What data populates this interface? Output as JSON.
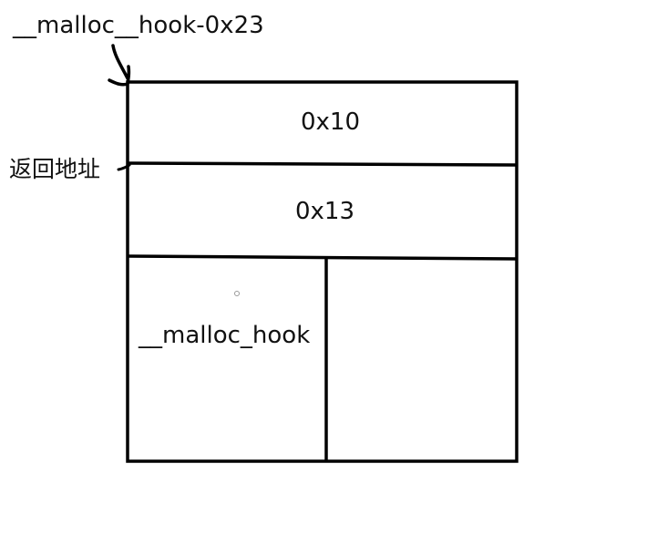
{
  "labels": {
    "top_pointer": "__malloc__hook-0x23",
    "side_pointer": "返回地址",
    "cell_row1": "0x10",
    "cell_row2": "0x13",
    "cell_bottom_left": "__malloc_hook"
  }
}
